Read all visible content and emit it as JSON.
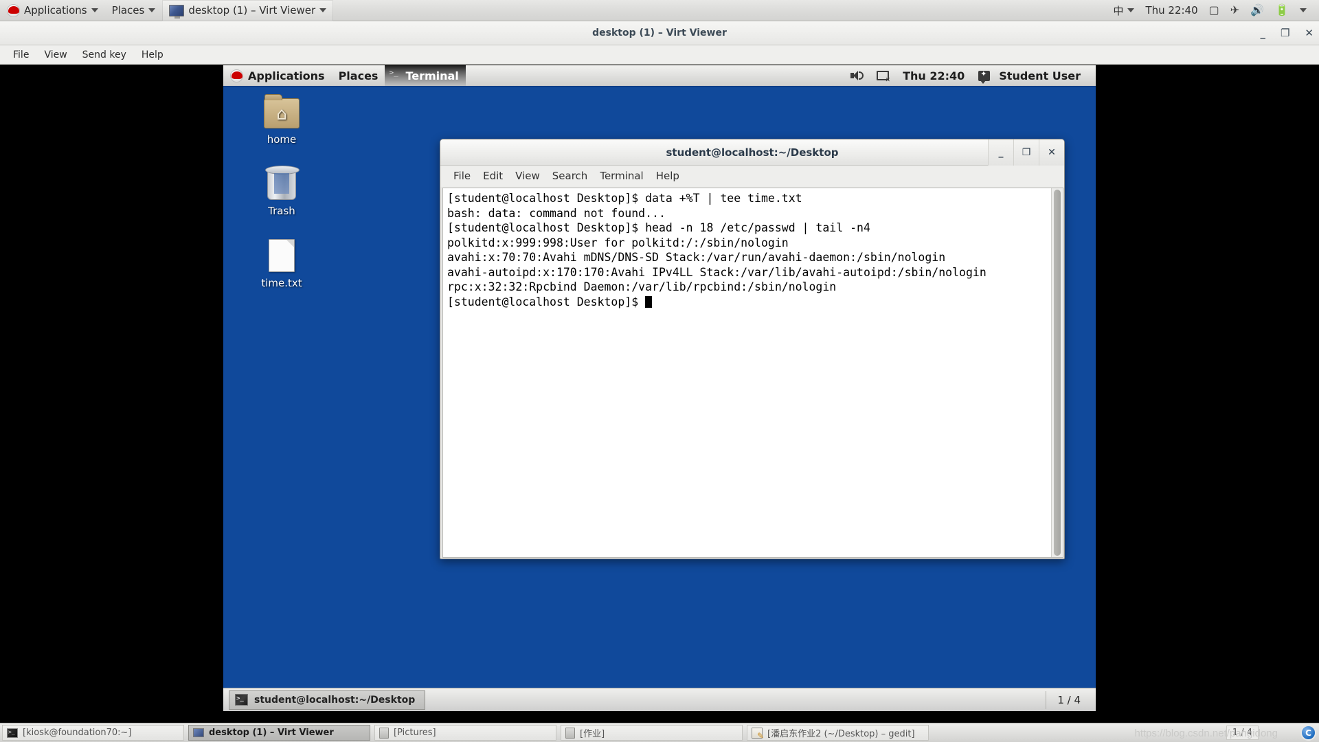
{
  "host_panel": {
    "applications_label": "Applications",
    "places_label": "Places",
    "window_label": "desktop (1) – Virt Viewer",
    "input_method": "中",
    "clock": "Thu 22:40",
    "icons": [
      "display-icon",
      "airplane-mode-icon",
      "volume-icon",
      "battery-icon",
      "chevron-down-icon"
    ]
  },
  "virt_viewer": {
    "title": "desktop (1) – Virt Viewer",
    "window_buttons": {
      "minimize": "_",
      "maximize": "❐",
      "close": "✕"
    },
    "menu": [
      "File",
      "View",
      "Send key",
      "Help"
    ]
  },
  "vm_panel": {
    "applications_label": "Applications",
    "places_label": "Places",
    "active_app_label": "Terminal",
    "clock": "Thu 22:40",
    "user": "Student User"
  },
  "desktop_icons": [
    {
      "name": "home",
      "label": "home",
      "icon": "home-folder-icon"
    },
    {
      "name": "trash",
      "label": "Trash",
      "icon": "trash-icon"
    },
    {
      "name": "time_txt",
      "label": "time.txt",
      "icon": "text-file-icon"
    }
  ],
  "terminal": {
    "title": "student@localhost:~/Desktop",
    "menu": [
      "File",
      "Edit",
      "View",
      "Search",
      "Terminal",
      "Help"
    ],
    "window_buttons": {
      "minimize": "_",
      "maximize": "❐",
      "close": "✕"
    },
    "lines": [
      "[student@localhost Desktop]$ data +%T | tee time.txt",
      "bash: data: command not found...",
      "[student@localhost Desktop]$ head -n 18 /etc/passwd | tail -n4",
      "polkitd:x:999:998:User for polkitd:/:/sbin/nologin",
      "avahi:x:70:70:Avahi mDNS/DNS-SD Stack:/var/run/avahi-daemon:/sbin/nologin",
      "avahi-autoipd:x:170:170:Avahi IPv4LL Stack:/var/lib/avahi-autoipd:/sbin/nologin",
      "rpc:x:32:32:Rpcbind Daemon:/var/lib/rpcbind:/sbin/nologin"
    ],
    "prompt": "[student@localhost Desktop]$ "
  },
  "vm_taskbar": {
    "task_label": "student@localhost:~/Desktop",
    "workspace_indicator": "1 / 4"
  },
  "host_taskbar": {
    "items": [
      {
        "label": "[kiosk@foundation70:~]",
        "icon": "terminal-icon",
        "active": false
      },
      {
        "label": "desktop (1) – Virt Viewer",
        "icon": "monitor-icon",
        "active": true
      },
      {
        "label": "[Pictures]",
        "icon": "file-manager-icon",
        "active": false
      },
      {
        "label": "[作业]",
        "icon": "file-manager-icon",
        "active": false
      },
      {
        "label": "[潘启东作业2 (~/Desktop) – gedit]",
        "icon": "gedit-icon",
        "active": false
      }
    ],
    "workspace_indicator": "1 / 4",
    "watermark": "https://blog.csdn.net/pangidong",
    "watermark_badge": "CSDN"
  },
  "colors": {
    "desktop_blue": "#10499b",
    "panel_grey": "#e2e2e0",
    "terminal_bg": "#ffffff",
    "terminal_fg": "#000000"
  }
}
